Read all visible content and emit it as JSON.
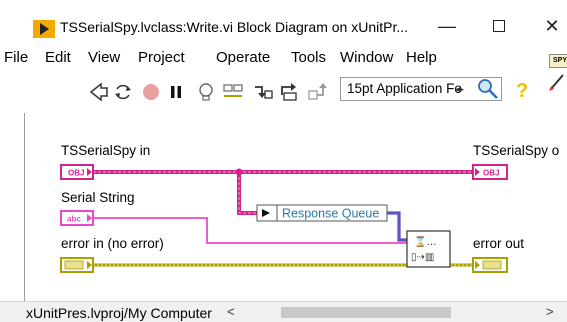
{
  "window": {
    "title": "TSSerialSpy.lvclass:Write.vi Block Diagram on xUnitPr...",
    "minimize_glyph": "—",
    "close_glyph": "✕"
  },
  "menu": [
    "File",
    "Edit",
    "View",
    "Project",
    "Operate",
    "Tools",
    "Window",
    "Help"
  ],
  "spy_badge": "SPY",
  "toolbar": {
    "icons": [
      "run-arrow-icon",
      "run-continuously-icon",
      "abort-icon",
      "pause-icon",
      "highlight-execution-icon",
      "retain-wire-values-icon",
      "step-into-icon",
      "step-over-icon",
      "step-out-icon"
    ],
    "font_select": "15pt Application Fo"
  },
  "diagram": {
    "in_class_label": "TSSerialSpy in",
    "out_class_label": "TSSerialSpy o",
    "serial_string_label": "Serial String",
    "error_in_label": "error in (no error)",
    "error_out_label": "error out",
    "response_queue_label": "Response Queue",
    "obj_tag": "OBJ",
    "abc_tag": "abc",
    "enqueue_glyph": "⌛…"
  },
  "status": {
    "path": "xUnitPres.lvproj/My Computer",
    "scroll_left": "<",
    "scroll_right": ">"
  },
  "colors": {
    "class_wire": "#d4248c",
    "string_wire": "#ea48c8",
    "error_wire": "#a8a000",
    "queue_wire": "#2d2da8"
  }
}
